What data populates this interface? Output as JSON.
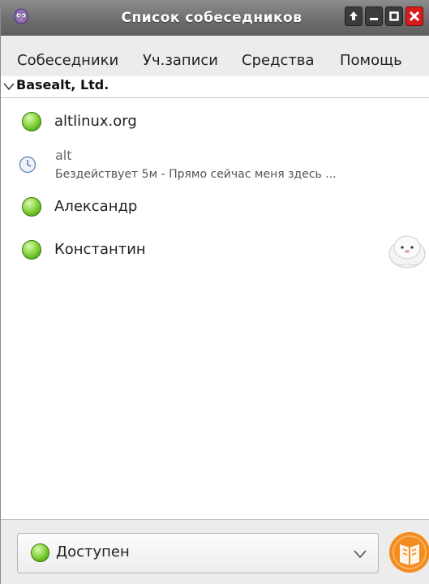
{
  "window": {
    "title": "Список собеседников",
    "buttons": [
      "up-arrow-icon",
      "minimize-icon",
      "maximize-icon",
      "close-icon"
    ]
  },
  "menu": {
    "items": [
      {
        "label": "Собеседники"
      },
      {
        "label": "Уч.записи"
      },
      {
        "label": "Средства"
      },
      {
        "label": "Помощь"
      }
    ]
  },
  "group": {
    "name": "Basealt, Ltd.",
    "icon": "chevron-down-icon"
  },
  "contacts": [
    {
      "name": "altlinux.org",
      "state": "available",
      "icon": "status-available-icon"
    },
    {
      "name": "alt",
      "status": "Бездействует 5м - Прямо сейчас меня здесь ...",
      "state": "idle",
      "icon": "status-idle-clock-icon"
    },
    {
      "name": "Александр",
      "state": "available",
      "icon": "status-available-icon"
    },
    {
      "name": "Константин",
      "state": "available",
      "icon": "status-available-icon",
      "avatar": "seal-avatar-icon"
    }
  ],
  "status_selector": {
    "value": "Доступен",
    "icon": "status-available-icon"
  },
  "colors": {
    "titlebar": "#6e6e6e",
    "available": "#6cc21f",
    "close_button": "#d81b1b",
    "tray_icon": "#f28c1e"
  }
}
